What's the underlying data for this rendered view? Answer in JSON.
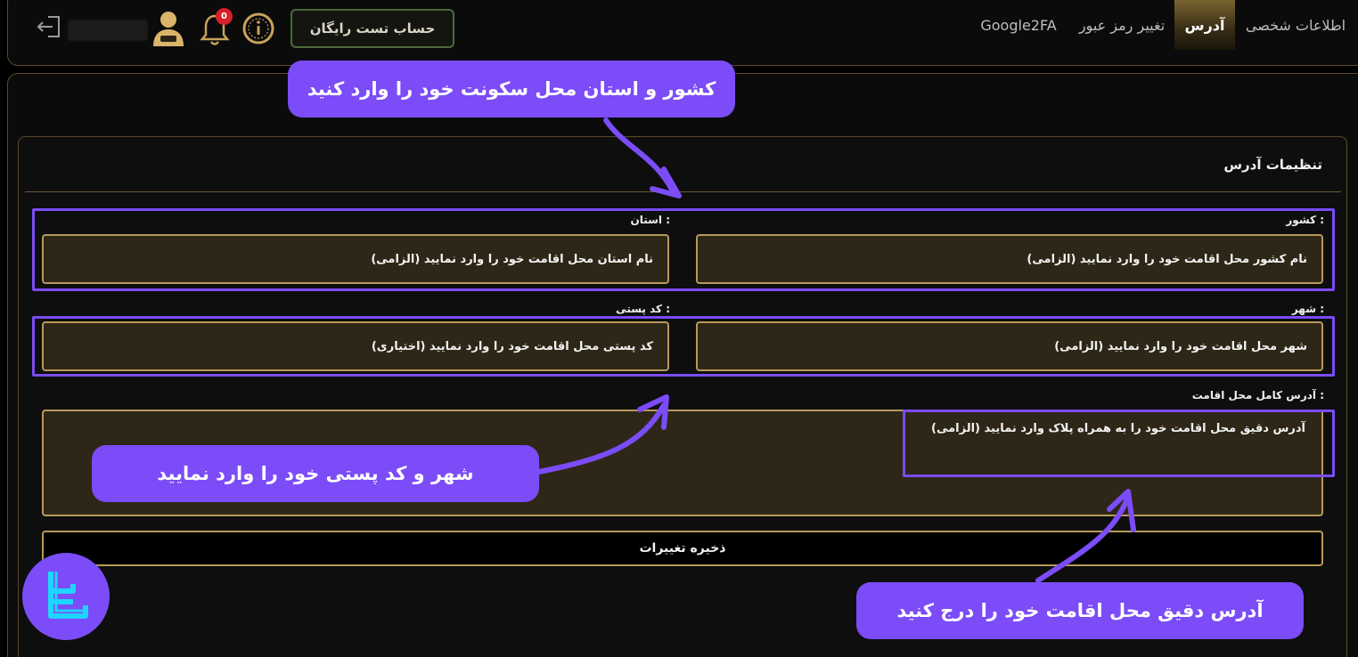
{
  "header": {
    "trial_button": "حساب تست رایگان",
    "notification_count": "0"
  },
  "tabs": {
    "personal": "اطلاعات شخصی",
    "address": "آدرس",
    "password": "تغییر رمز عبور",
    "twofa": "Google2FA"
  },
  "form": {
    "title": "تنظیمات آدرس",
    "country_label": "کشور :",
    "country_placeholder": "نام کشور محل اقامت خود را وارد نمایید (الزامی)",
    "province_label": "استان :",
    "province_placeholder": "نام استان محل اقامت خود را وارد نمایید (الزامی)",
    "city_label": "شهر :",
    "city_placeholder": "شهر محل اقامت خود را وارد نمایید (الزامی)",
    "postal_label": "کد پستی :",
    "postal_placeholder": "کد پستی محل اقامت خود را وارد نمایید (اختیاری)",
    "address_label": "آدرس کامل محل اقامت :",
    "address_placeholder": "آدرس دقیق محل اقامت خود را به همراه پلاک وارد نمایید (الزامی)",
    "save_label": "ذخیره تغییرات"
  },
  "callouts": {
    "country": "کشور و استان محل سکونت خود را وارد کنید",
    "city": "شهر و کد پستی خود را وارد نمایید",
    "address": "آدرس دقیق محل اقامت خود را درج کنید"
  },
  "colors": {
    "accent": "#7b4cf7",
    "gold_border": "#b79a5a",
    "field_bg": "#2e2717"
  }
}
